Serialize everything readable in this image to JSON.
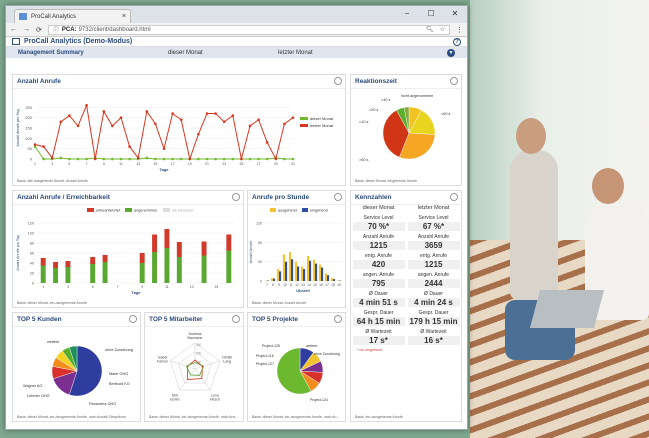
{
  "browser": {
    "tab_title": "ProCall Analytics",
    "url_host": "PCA:",
    "url_path": "9732/client/dashboard.html",
    "controls": [
      "−",
      "☐",
      "✕"
    ]
  },
  "app": {
    "title": "ProCall Analytics (Demo-Modus)",
    "summary": {
      "label": "Management Summary",
      "col1": "dieser Monat",
      "col2": "letzter Monat"
    }
  },
  "panels": {
    "anzahl_anrufe": {
      "title": "Anzahl Anrufe",
      "ylabel": "Anzahl Anrufe pro Tag",
      "xlabel": "Tage",
      "footer": "Basis: alle ausgehende Anrufe, Anzahl Anrufe",
      "legend": [
        "dieser Monat",
        "letzter Monat"
      ]
    },
    "reaktionszeit": {
      "title": "Reaktionszeit",
      "footer": "Basis: dieser Monat, eingehende Anrufe",
      "labels": [
        "<20 s",
        "<40 s",
        "<60 s",
        ">60 s",
        "<10 s",
        "nicht angenommen"
      ]
    },
    "erreichbarkeit": {
      "title": "Anzahl Anrufe / Erreichbarkeit",
      "legend": [
        "unbeantwortet",
        "angenommen",
        "nie Benutzer"
      ],
      "ylabel": "Anzahl Anrufe pro Tag",
      "xlabel": "Tage",
      "footer": "Basis: dieser Monat, ein-/ausgehende Anrufe"
    },
    "pro_stunde": {
      "title": "Anrufe pro Stunde",
      "legend": [
        "ausgehend",
        "eingehend"
      ],
      "ylabel": "Anzahl Anrufe",
      "xlabel": "Uhrzeit",
      "footer": "Basis: dieser Monat, Anzahl Anrufe"
    },
    "kennzahlen": {
      "title": "Kennzahlen",
      "col1": "dieser Monat",
      "col2": "letzter Monat",
      "rows": [
        {
          "label": "Service Level",
          "v1": "70 %*",
          "v2": "67 %*"
        },
        {
          "label": "Anzahl Anrufe",
          "v1": "1215",
          "v2": "3659"
        },
        {
          "label": "entg. Anrufe",
          "v1": "420",
          "v2": "1215"
        },
        {
          "label": "angen. Anrufe",
          "v1": "795",
          "v2": "2444"
        },
        {
          "label": "Ø Dauer",
          "v1": "4 min 51 s",
          "v2": "4 min 24 s"
        },
        {
          "label": "Gespr. Dauer",
          "v1": "64 h 15 min",
          "v2": "179 h 15 min"
        },
        {
          "label": "Ø Wartezeit",
          "v1": "17 s*",
          "v2": "16 s*"
        }
      ],
      "note": "* nur eingehend",
      "footer": "Basis: ein-/ausgehende Anrufe"
    },
    "top_kunden": {
      "title": "TOP 5 Kunden",
      "labels": [
        "weitere",
        "ohne Zuordnung",
        "Maier OHG",
        "Berthold KG",
        "Panamera OHG",
        "Lehmer OHG",
        "Wagner AG"
      ],
      "footer": "Basis: dieser Monat, ein-/ausgehende Anrufe, nach Anzahl Gespräche"
    },
    "top_mitarbeiter": {
      "title": "TOP 5 Mitarbeiter",
      "labels": [
        "Andreas Baumann",
        "Dimitri Lang",
        "Lena Hirsch",
        "Dirk Bohm",
        "Isabel Farmer"
      ],
      "ticks": [
        "300",
        "200",
        "100"
      ],
      "footer": "Basis: dieser Monat, ein-/ausgehende Anrufe, nach Anz..."
    },
    "top_projekte": {
      "title": "TOP 5 Projekte",
      "labels": [
        "Project-125",
        "weitere",
        "ohne Zuordnung",
        "Project-116",
        "Project-127",
        "Project-124"
      ],
      "footer": "Basis: dieser Monat, ein-/ausgehende Anrufe, nach An..."
    }
  },
  "chart_data": [
    {
      "type": "line",
      "x": [
        1,
        2,
        3,
        4,
        5,
        6,
        7,
        8,
        9,
        10,
        11,
        12,
        13,
        14,
        15,
        16,
        17,
        18,
        19,
        20,
        21,
        22,
        23,
        24,
        25,
        26,
        27,
        28,
        29,
        30,
        31
      ],
      "series": [
        {
          "name": "dieser Monat",
          "color": "#6fba2c",
          "values": [
            60,
            0,
            0,
            5,
            0,
            0,
            0,
            5,
            0,
            0,
            0,
            0,
            0,
            5,
            0,
            0,
            0,
            0,
            0,
            0,
            0,
            0,
            0,
            0,
            0,
            0,
            0,
            0,
            5,
            0,
            0
          ]
        },
        {
          "name": "letzter Monat",
          "color": "#d9361f",
          "values": [
            70,
            60,
            5,
            180,
            210,
            160,
            260,
            0,
            230,
            160,
            200,
            60,
            5,
            230,
            170,
            50,
            220,
            190,
            0,
            120,
            220,
            220,
            180,
            210,
            0,
            160,
            190,
            80,
            0,
            170,
            200
          ]
        }
      ],
      "ylim": [
        0,
        300
      ]
    },
    {
      "type": "pie",
      "labels": [
        "<20 s",
        "<40 s",
        ">60 s",
        "nicht angenommen",
        "<10 s",
        "<60 s"
      ],
      "values": [
        8,
        18,
        30,
        36,
        5,
        3
      ],
      "colors": [
        "#f3c323",
        "#e7d520",
        "#f5a623",
        "#d03516",
        "#5bb02e",
        "#8aa83a"
      ]
    },
    {
      "type": "bar",
      "categories": [
        "1",
        "2",
        "3",
        "4",
        "5",
        "6",
        "7",
        "8",
        "9",
        "10",
        "11",
        "12",
        "13",
        "14",
        "15",
        "16"
      ],
      "series": [
        {
          "name": "angenommen",
          "color": "#5aa832",
          "values": [
            35,
            30,
            32,
            0,
            38,
            42,
            0,
            0,
            40,
            62,
            70,
            52,
            0,
            55,
            0,
            65
          ]
        },
        {
          "name": "unbeantwortet",
          "color": "#d13a2a",
          "values": [
            15,
            12,
            12,
            0,
            14,
            14,
            0,
            0,
            20,
            35,
            38,
            30,
            0,
            28,
            0,
            32
          ]
        }
      ],
      "ylim": [
        0,
        120
      ]
    },
    {
      "type": "bar",
      "categories": [
        "7",
        "8",
        "9",
        "10",
        "11",
        "12",
        "13",
        "14",
        "15",
        "16",
        "17",
        "18",
        "19"
      ],
      "series": [
        {
          "name": "eingehend",
          "color": "#2f4ea3",
          "values": [
            1,
            5,
            20,
            40,
            45,
            30,
            25,
            42,
            36,
            28,
            12,
            4,
            1
          ]
        },
        {
          "name": "ausgehend",
          "color": "#f2c230",
          "values": [
            1,
            6,
            25,
            55,
            60,
            40,
            30,
            52,
            44,
            34,
            16,
            6,
            1
          ]
        }
      ],
      "ylim": [
        0,
        120
      ]
    },
    {
      "type": "pie",
      "labels": [
        "weitere",
        "ohne Zuordnung",
        "Maier OHG",
        "Berthold KG",
        "Panamera OHG",
        "Lehmer OHG",
        "Wagner AG"
      ],
      "values": [
        55,
        15,
        8,
        6,
        6,
        5,
        5
      ],
      "colors": [
        "#2f3e9e",
        "#7b2f8f",
        "#d8302a",
        "#f28c1c",
        "#f5d325",
        "#5aad2a",
        "#1f8f5f"
      ]
    },
    {
      "type": "pie",
      "labels": [
        "weitere",
        "ohne Zuordnung",
        "Project-125",
        "Project-116",
        "Project-127",
        "Project-124"
      ],
      "values": [
        10,
        8,
        8,
        8,
        8,
        58
      ],
      "colors": [
        "#2f3e9e",
        "#f2c230",
        "#7b2f8f",
        "#d8302a",
        "#f28c1c",
        "#6cb82f"
      ]
    }
  ]
}
